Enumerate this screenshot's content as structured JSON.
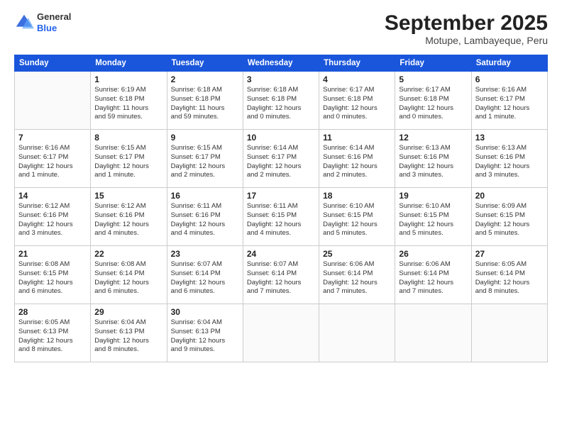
{
  "header": {
    "logo_general": "General",
    "logo_blue": "Blue",
    "month_title": "September 2025",
    "location": "Motupe, Lambayeque, Peru"
  },
  "days_of_week": [
    "Sunday",
    "Monday",
    "Tuesday",
    "Wednesday",
    "Thursday",
    "Friday",
    "Saturday"
  ],
  "weeks": [
    [
      {
        "day": "",
        "info": ""
      },
      {
        "day": "1",
        "info": "Sunrise: 6:19 AM\nSunset: 6:18 PM\nDaylight: 11 hours\nand 59 minutes."
      },
      {
        "day": "2",
        "info": "Sunrise: 6:18 AM\nSunset: 6:18 PM\nDaylight: 11 hours\nand 59 minutes."
      },
      {
        "day": "3",
        "info": "Sunrise: 6:18 AM\nSunset: 6:18 PM\nDaylight: 12 hours\nand 0 minutes."
      },
      {
        "day": "4",
        "info": "Sunrise: 6:17 AM\nSunset: 6:18 PM\nDaylight: 12 hours\nand 0 minutes."
      },
      {
        "day": "5",
        "info": "Sunrise: 6:17 AM\nSunset: 6:18 PM\nDaylight: 12 hours\nand 0 minutes."
      },
      {
        "day": "6",
        "info": "Sunrise: 6:16 AM\nSunset: 6:17 PM\nDaylight: 12 hours\nand 1 minute."
      }
    ],
    [
      {
        "day": "7",
        "info": "Sunrise: 6:16 AM\nSunset: 6:17 PM\nDaylight: 12 hours\nand 1 minute."
      },
      {
        "day": "8",
        "info": "Sunrise: 6:15 AM\nSunset: 6:17 PM\nDaylight: 12 hours\nand 1 minute."
      },
      {
        "day": "9",
        "info": "Sunrise: 6:15 AM\nSunset: 6:17 PM\nDaylight: 12 hours\nand 2 minutes."
      },
      {
        "day": "10",
        "info": "Sunrise: 6:14 AM\nSunset: 6:17 PM\nDaylight: 12 hours\nand 2 minutes."
      },
      {
        "day": "11",
        "info": "Sunrise: 6:14 AM\nSunset: 6:16 PM\nDaylight: 12 hours\nand 2 minutes."
      },
      {
        "day": "12",
        "info": "Sunrise: 6:13 AM\nSunset: 6:16 PM\nDaylight: 12 hours\nand 3 minutes."
      },
      {
        "day": "13",
        "info": "Sunrise: 6:13 AM\nSunset: 6:16 PM\nDaylight: 12 hours\nand 3 minutes."
      }
    ],
    [
      {
        "day": "14",
        "info": "Sunrise: 6:12 AM\nSunset: 6:16 PM\nDaylight: 12 hours\nand 3 minutes."
      },
      {
        "day": "15",
        "info": "Sunrise: 6:12 AM\nSunset: 6:16 PM\nDaylight: 12 hours\nand 4 minutes."
      },
      {
        "day": "16",
        "info": "Sunrise: 6:11 AM\nSunset: 6:16 PM\nDaylight: 12 hours\nand 4 minutes."
      },
      {
        "day": "17",
        "info": "Sunrise: 6:11 AM\nSunset: 6:15 PM\nDaylight: 12 hours\nand 4 minutes."
      },
      {
        "day": "18",
        "info": "Sunrise: 6:10 AM\nSunset: 6:15 PM\nDaylight: 12 hours\nand 5 minutes."
      },
      {
        "day": "19",
        "info": "Sunrise: 6:10 AM\nSunset: 6:15 PM\nDaylight: 12 hours\nand 5 minutes."
      },
      {
        "day": "20",
        "info": "Sunrise: 6:09 AM\nSunset: 6:15 PM\nDaylight: 12 hours\nand 5 minutes."
      }
    ],
    [
      {
        "day": "21",
        "info": "Sunrise: 6:08 AM\nSunset: 6:15 PM\nDaylight: 12 hours\nand 6 minutes."
      },
      {
        "day": "22",
        "info": "Sunrise: 6:08 AM\nSunset: 6:14 PM\nDaylight: 12 hours\nand 6 minutes."
      },
      {
        "day": "23",
        "info": "Sunrise: 6:07 AM\nSunset: 6:14 PM\nDaylight: 12 hours\nand 6 minutes."
      },
      {
        "day": "24",
        "info": "Sunrise: 6:07 AM\nSunset: 6:14 PM\nDaylight: 12 hours\nand 7 minutes."
      },
      {
        "day": "25",
        "info": "Sunrise: 6:06 AM\nSunset: 6:14 PM\nDaylight: 12 hours\nand 7 minutes."
      },
      {
        "day": "26",
        "info": "Sunrise: 6:06 AM\nSunset: 6:14 PM\nDaylight: 12 hours\nand 7 minutes."
      },
      {
        "day": "27",
        "info": "Sunrise: 6:05 AM\nSunset: 6:14 PM\nDaylight: 12 hours\nand 8 minutes."
      }
    ],
    [
      {
        "day": "28",
        "info": "Sunrise: 6:05 AM\nSunset: 6:13 PM\nDaylight: 12 hours\nand 8 minutes."
      },
      {
        "day": "29",
        "info": "Sunrise: 6:04 AM\nSunset: 6:13 PM\nDaylight: 12 hours\nand 8 minutes."
      },
      {
        "day": "30",
        "info": "Sunrise: 6:04 AM\nSunset: 6:13 PM\nDaylight: 12 hours\nand 9 minutes."
      },
      {
        "day": "",
        "info": ""
      },
      {
        "day": "",
        "info": ""
      },
      {
        "day": "",
        "info": ""
      },
      {
        "day": "",
        "info": ""
      }
    ]
  ]
}
